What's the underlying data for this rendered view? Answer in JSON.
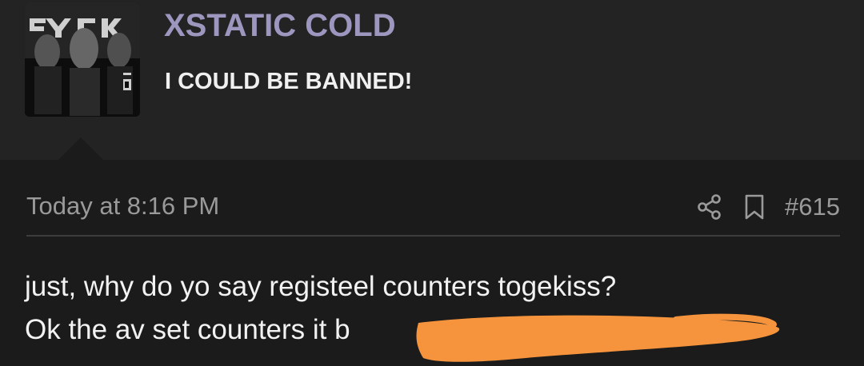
{
  "user": {
    "name": "XSTATIC COLD",
    "title": "I COULD BE BANNED!"
  },
  "post": {
    "timestamp": "Today at 8:16 PM",
    "number": "#615",
    "lines": [
      "just, why do yo say registeel counters togekiss?",
      "Ok the av set counters it b"
    ]
  },
  "icons": {
    "share": "share-icon",
    "bookmark": "bookmark-icon"
  },
  "colors": {
    "username": "#9d97c0",
    "redaction": "#f5943d"
  }
}
